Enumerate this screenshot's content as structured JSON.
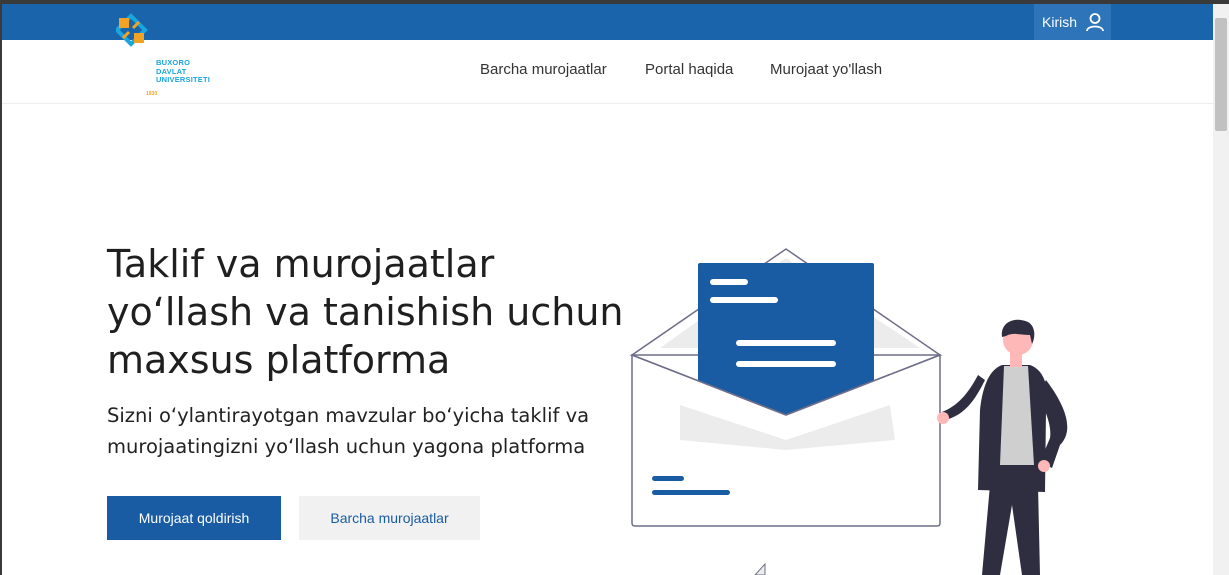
{
  "topbar": {
    "login_label": "Kirish",
    "login_icon": "user-icon"
  },
  "logo": {
    "lines": [
      "BUXORO",
      "DAVLAT",
      "UNIVERSITETI"
    ],
    "year": "1930"
  },
  "nav": [
    {
      "label": "Barcha murojaatlar"
    },
    {
      "label": "Portal haqida"
    },
    {
      "label": "Murojaat yo'llash"
    }
  ],
  "hero": {
    "title_lines": [
      "Taklif va murojaatlar",
      "yo‘llash va tanishish uchun",
      "maxsus platforma"
    ],
    "subtitle_lines": [
      "Sizni o‘ylantirayotgan mavzular bo‘yicha taklif va",
      "murojaatingizni yo‘llash uchun yagona platforma"
    ],
    "primary_button": "Murojaat qoldirish",
    "secondary_button": "Barcha murojaatlar"
  },
  "colors": {
    "brand_blue": "#1a64ab",
    "button_blue": "#1a5ca3",
    "logo_cyan": "#1aa6e0",
    "logo_orange": "#f2a324"
  }
}
